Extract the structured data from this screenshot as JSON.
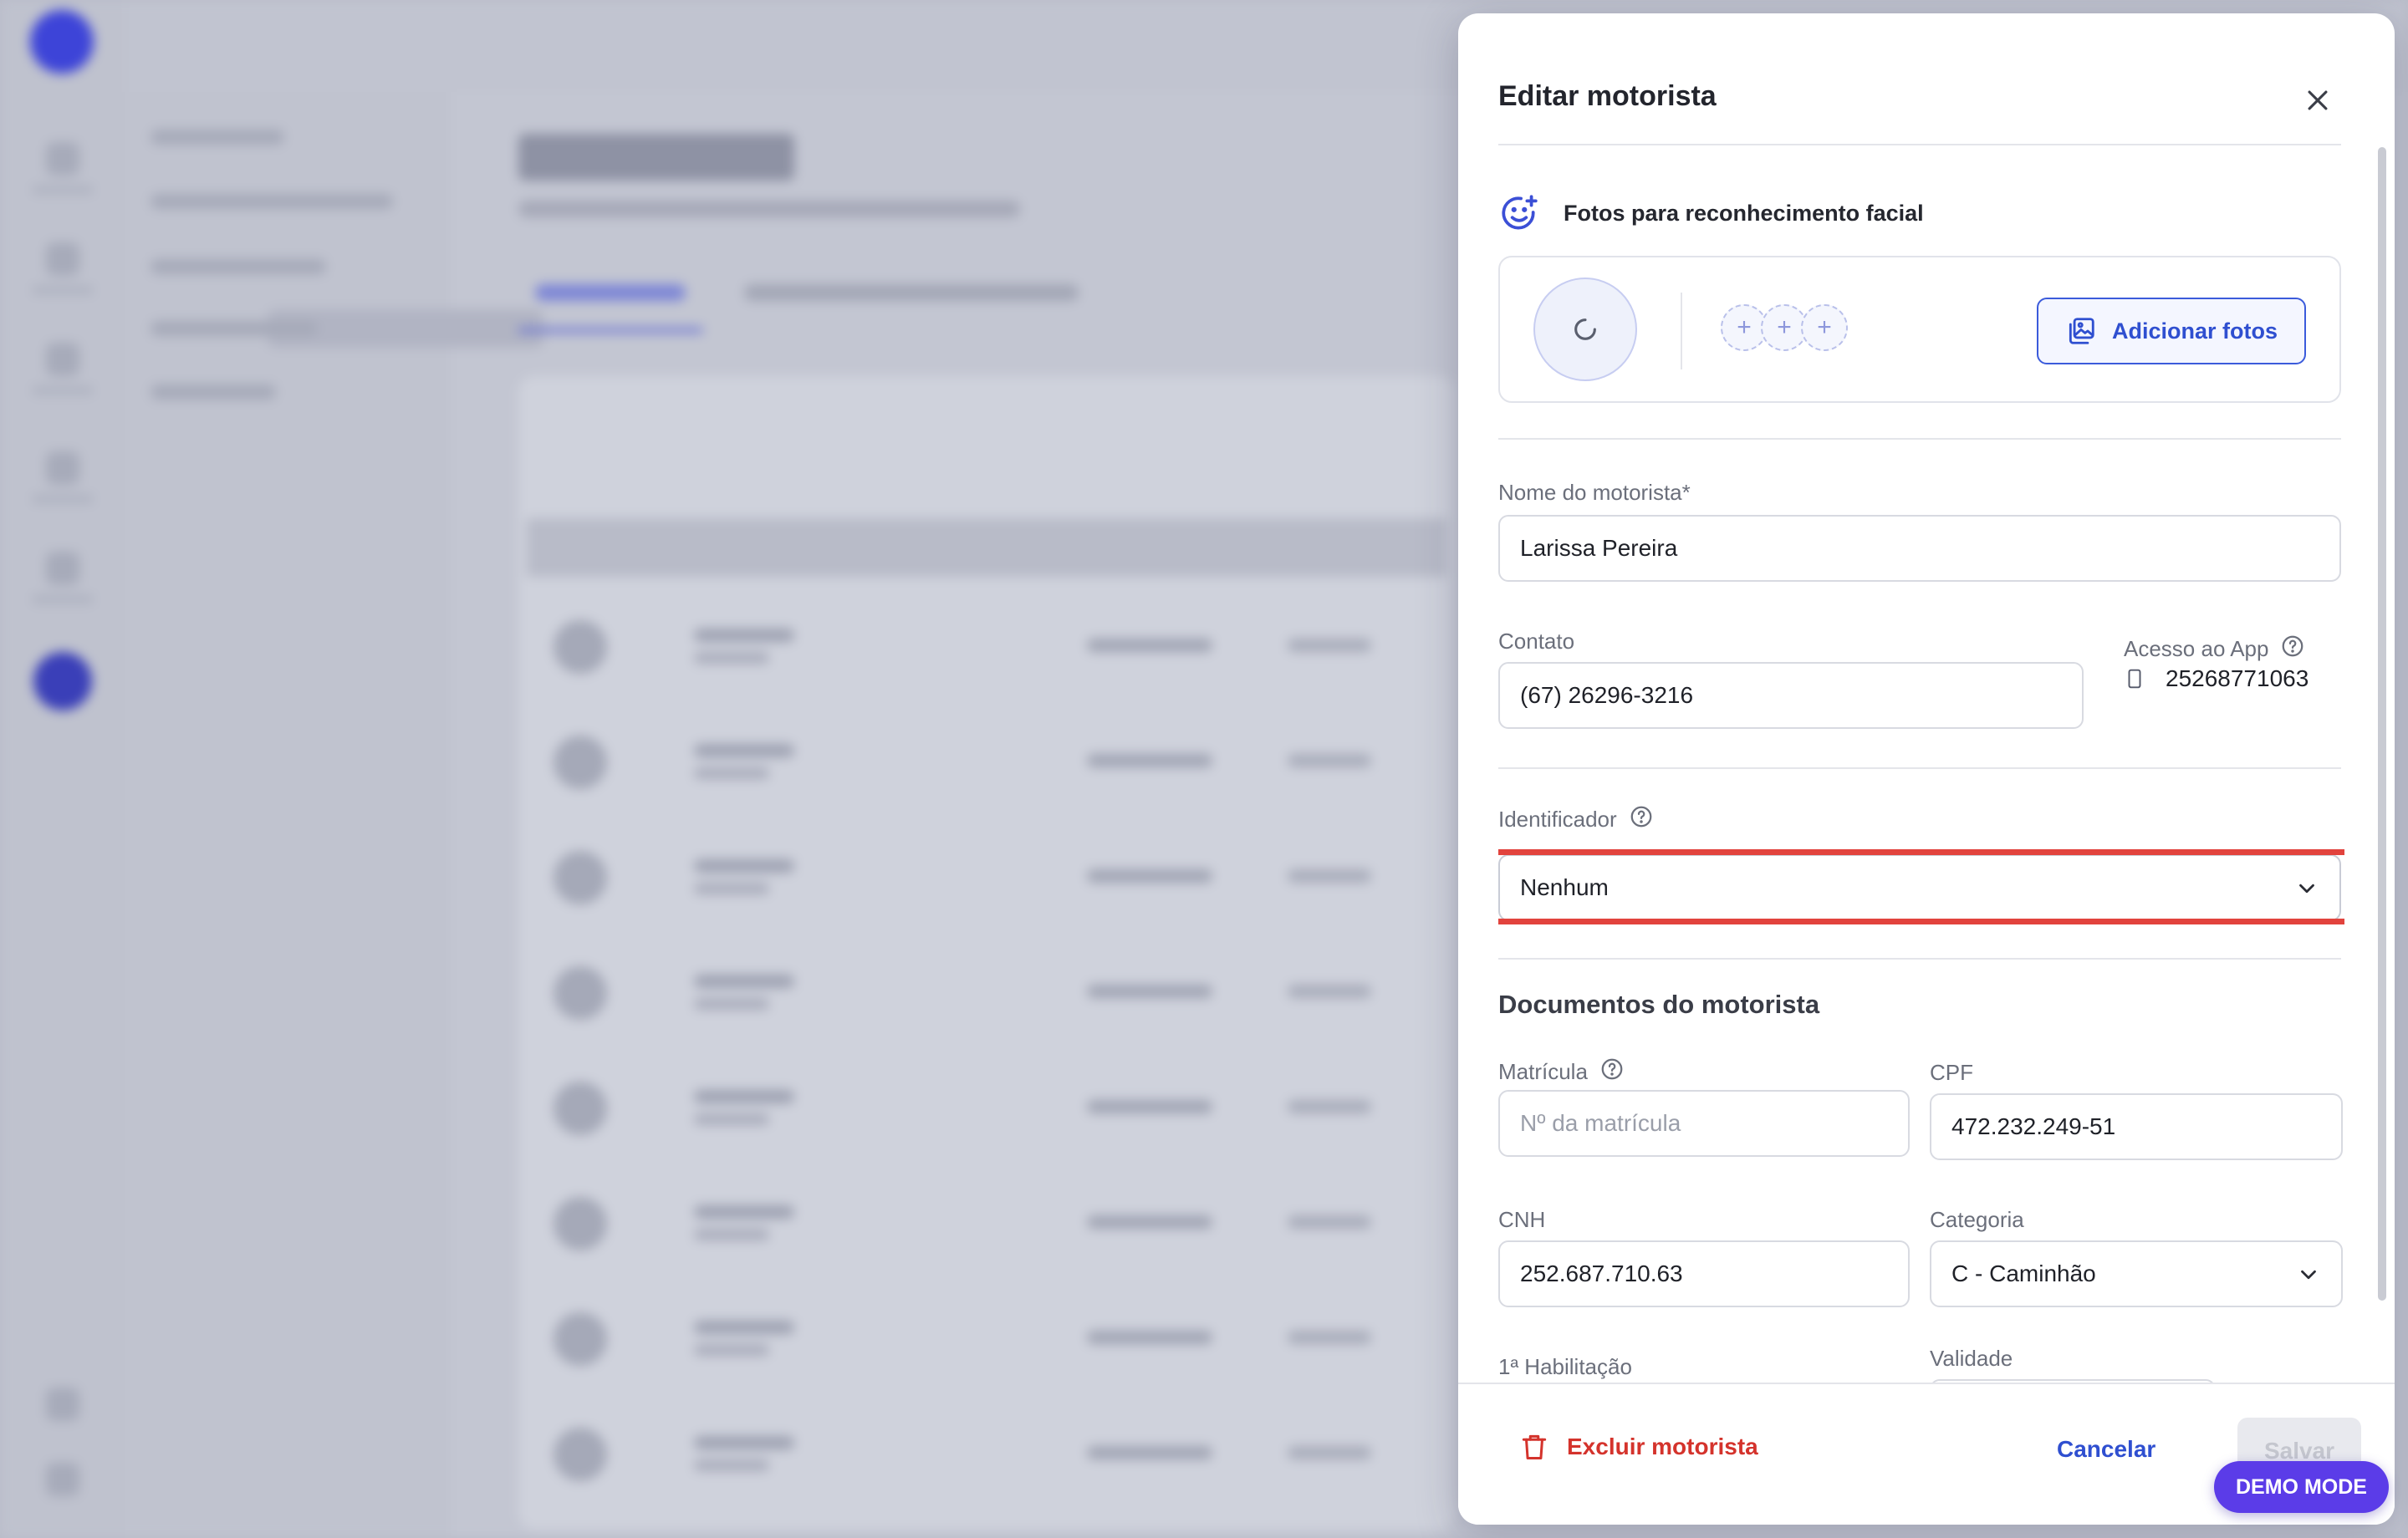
{
  "modal": {
    "title": "Editar motorista",
    "photos": {
      "title": "Fotos para reconhecimento facial",
      "add_button": "Adicionar fotos",
      "slot_symbol": "+"
    },
    "fields": {
      "name": {
        "label": "Nome do motorista*",
        "value": "Larissa Pereira"
      },
      "contact": {
        "label": "Contato",
        "value": "(67) 26296-3216"
      },
      "app_access": {
        "label": "Acesso ao App",
        "value": "25268771063"
      },
      "identifier": {
        "label": "Identificador",
        "selected": "Nenhum"
      }
    },
    "documents": {
      "title": "Documentos do motorista",
      "registration": {
        "label": "Matrícula",
        "placeholder": "Nº da matrícula"
      },
      "cpf": {
        "label": "CPF",
        "value": "472.232.249-51"
      },
      "cnh": {
        "label": "CNH",
        "value": "252.687.710.63"
      },
      "category": {
        "label": "Categoria",
        "selected": "C - Caminhão"
      },
      "first_license": {
        "label": "1ª Habilitação"
      },
      "validity": {
        "label": "Validade"
      }
    },
    "footer": {
      "delete": "Excluir motorista",
      "cancel": "Cancelar",
      "save": "Salvar"
    }
  },
  "badge": {
    "demo_mode": "DEMO MODE"
  },
  "icons": {
    "close": "close-icon",
    "face": "face-scan-icon",
    "gallery": "image-gallery-icon",
    "help": "help-circle-icon",
    "phone": "smartphone-icon",
    "chevron": "chevron-down-icon",
    "trash": "trash-icon",
    "loading": "loading-spinner-icon"
  },
  "colors": {
    "primary": "#2f4fd0",
    "danger": "#d4332c",
    "highlight": "#e2433d",
    "demo_badge": "#5b3ce8"
  }
}
